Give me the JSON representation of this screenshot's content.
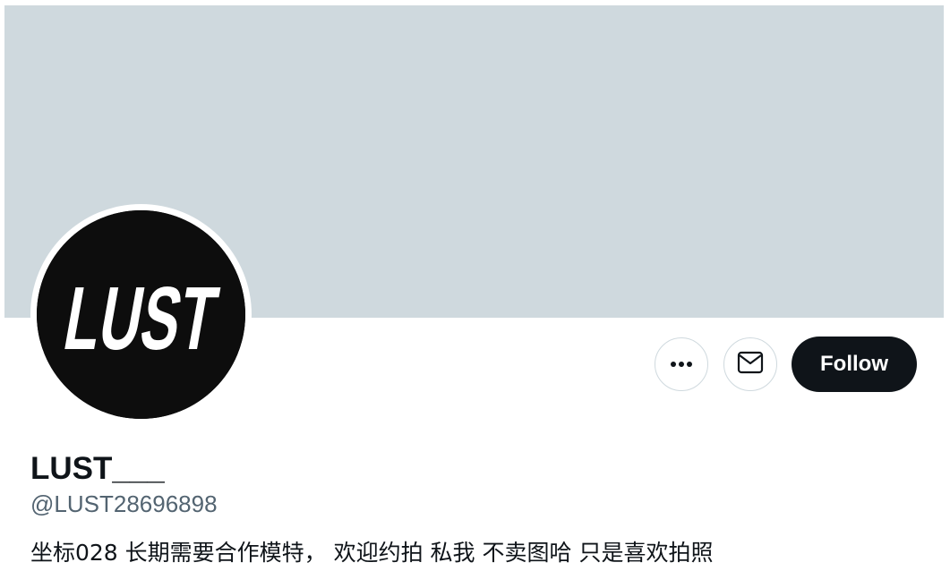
{
  "profile": {
    "banner_color": "#cfd9de",
    "avatar": {
      "logo_text": "LUST",
      "background_color": "#0d0d0d",
      "text_color": "#ffffff"
    },
    "display_name": "LUST___",
    "handle": "@LUST28696898",
    "bio": "坐标028 长期需要合作模特， 欢迎约拍 私我 不卖图哈 只是喜欢拍照"
  },
  "actions": {
    "more_icon": "more-horizontal-icon",
    "message_icon": "envelope-icon",
    "follow_label": "Follow",
    "follow_bg_color": "#0f1419"
  }
}
